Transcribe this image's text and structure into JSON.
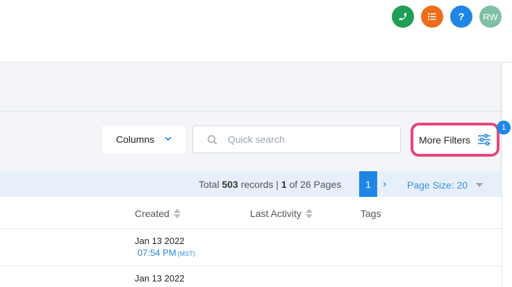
{
  "topbar": {
    "avatar_initials": "RW",
    "help_label": "?",
    "colors": {
      "phone": "#1e9e57",
      "list": "#ef6c1a",
      "help": "#1f86e6",
      "avatar": "#7fbfa3"
    }
  },
  "toolbar": {
    "columns_label": "Columns",
    "search_placeholder": "Quick search",
    "more_filters_label": "More Filters",
    "filter_badge": "1"
  },
  "pager": {
    "total_label": "Total",
    "total_records": "503",
    "records_label": "records |",
    "current_page": "1",
    "of_label": "of 26 Pages",
    "current_page_button": "1",
    "next_label": "›",
    "page_size_label": "Page Size: 20"
  },
  "table": {
    "columns": [
      "Created",
      "Last Activity",
      "Tags"
    ],
    "rows": [
      {
        "date": "Jan 13 2022",
        "time": "07:54 PM",
        "tz": "(MST)"
      },
      {
        "date": "Jan 13 2022",
        "time": "",
        "tz": ""
      }
    ]
  },
  "colors": {
    "accent": "#1f86e6",
    "highlight": "#e8457a"
  }
}
